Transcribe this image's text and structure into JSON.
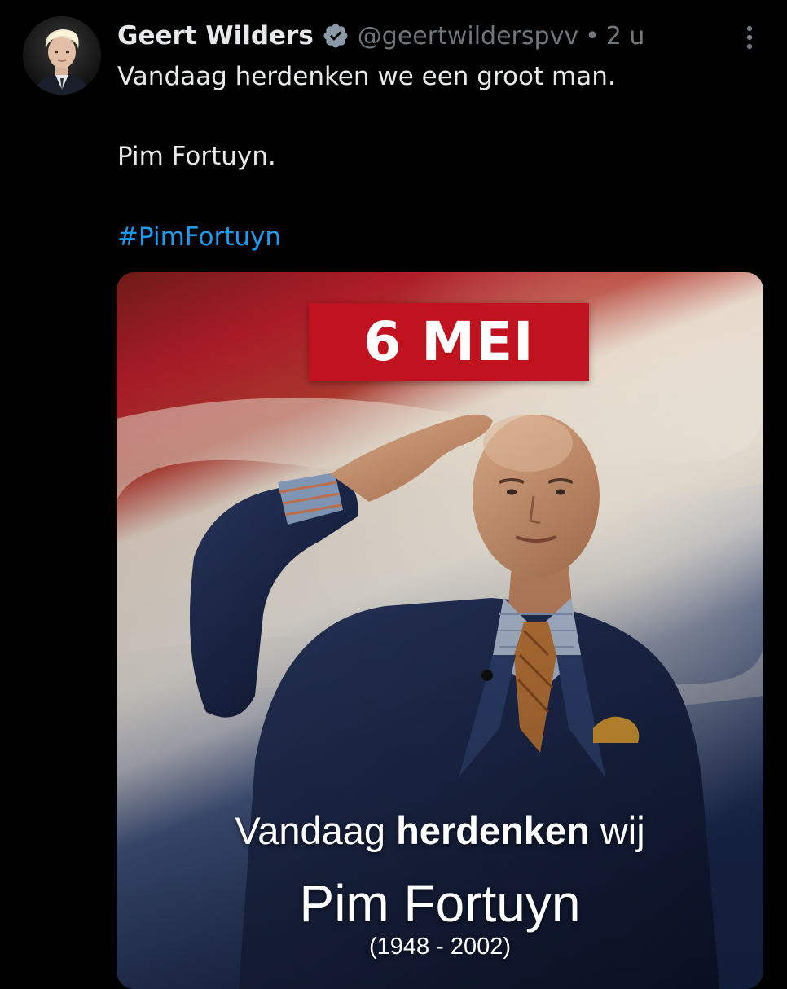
{
  "tweet": {
    "author": {
      "display_name": "Geert Wilders",
      "handle": "@geertwilderspvv",
      "verified_icon": "verified-badge-icon",
      "avatar_icon": "profile-photo"
    },
    "separator": "•",
    "timestamp": "2 u",
    "more_icon": "more-options-vertical-icon",
    "text_lines": [
      "Vandaag herdenken we een groot man.",
      "Pim Fortuyn."
    ],
    "hashtag": "#PimFortuyn"
  },
  "media": {
    "date_banner": "6 MEI",
    "caption_word1": "Vandaag",
    "caption_word2": "herdenken",
    "caption_word3": "wij",
    "caption_name": "Pim Fortuyn",
    "caption_years": "(1948 - 2002)"
  },
  "colors": {
    "background": "#000000",
    "text_primary": "#e7e9ea",
    "text_secondary": "#71767b",
    "link": "#1d9bf0",
    "banner_red": "#c0131f",
    "flag_red": "#ae1c28",
    "flag_white": "#f4efe6",
    "flag_blue": "#21468b"
  }
}
